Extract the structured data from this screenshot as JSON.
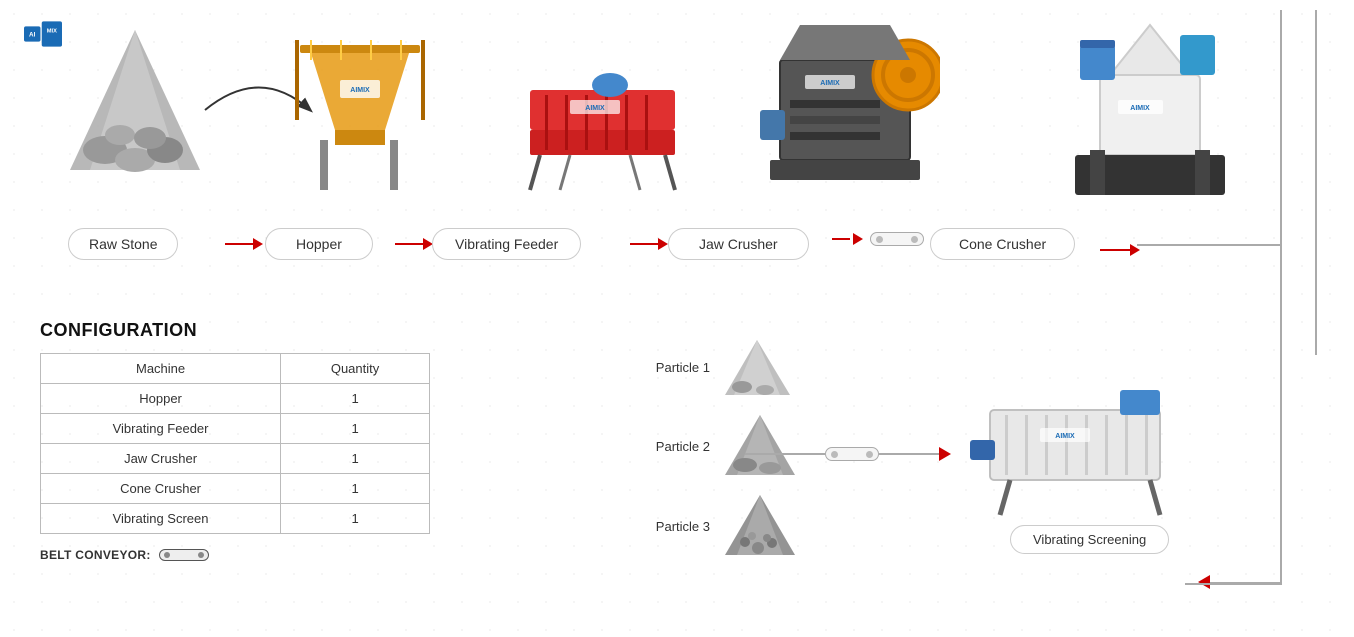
{
  "logo": {
    "text": "AIMIX"
  },
  "flow": {
    "nodes": [
      {
        "label": "Raw Stone"
      },
      {
        "label": "Hopper"
      },
      {
        "label": "Vibrating Feeder"
      },
      {
        "label": "Jaw Crusher"
      },
      {
        "label": "Cone Crusher"
      }
    ]
  },
  "config": {
    "title": "CONFIGURATION",
    "table": {
      "headers": [
        "Machine",
        "Quantity"
      ],
      "rows": [
        [
          "Hopper",
          "1"
        ],
        [
          "Vibrating Feeder",
          "1"
        ],
        [
          "Jaw Crusher",
          "1"
        ],
        [
          "Cone Crusher",
          "1"
        ],
        [
          "Vibrating Screen",
          "1"
        ]
      ]
    },
    "belt_conveyor_label": "BELT CONVEYOR:"
  },
  "particles": [
    {
      "label": "Particle 1"
    },
    {
      "label": "Particle 2"
    },
    {
      "label": "Particle 3"
    }
  ],
  "vibrating_screen": {
    "label": "Vibrating Screening"
  },
  "colors": {
    "red": "#c00000",
    "blue": "#1a6bb5",
    "arrow_red": "#cc0000",
    "line_gray": "#aaaaaa"
  }
}
